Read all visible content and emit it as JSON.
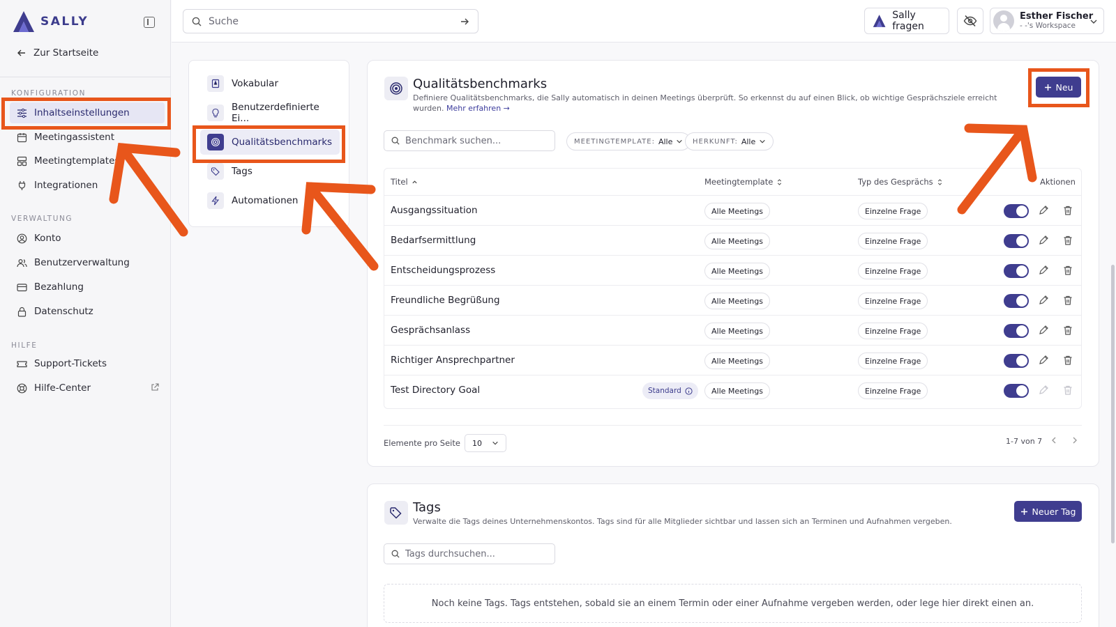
{
  "app": {
    "brand": "SALLY",
    "back_link": "Zur Startseite"
  },
  "sidebar": {
    "sections": [
      {
        "title": "KONFIGURATION",
        "items": [
          {
            "label": "Inhaltseinstellungen",
            "icon": "sliders-icon",
            "active": true
          },
          {
            "label": "Meetingassistent",
            "icon": "calendar-icon"
          },
          {
            "label": "Meetingtemplates",
            "icon": "template-icon"
          },
          {
            "label": "Integrationen",
            "icon": "plug-icon"
          }
        ]
      },
      {
        "title": "VERWALTUNG",
        "items": [
          {
            "label": "Konto",
            "icon": "user-circle-icon"
          },
          {
            "label": "Benutzerverwaltung",
            "icon": "users-icon"
          },
          {
            "label": "Bezahlung",
            "icon": "credit-card-icon"
          },
          {
            "label": "Datenschutz",
            "icon": "lock-icon"
          }
        ]
      },
      {
        "title": "HILFE",
        "items": [
          {
            "label": "Support-Tickets",
            "icon": "ticket-icon"
          },
          {
            "label": "Hilfe-Center",
            "icon": "lifebuoy-icon",
            "external": true
          }
        ]
      }
    ]
  },
  "topbar": {
    "search_placeholder": "Suche",
    "ask_sally": "Sally fragen",
    "user_name": "Esther Fischer",
    "workspace": "- -'s Workspace"
  },
  "content_nav": {
    "items": [
      {
        "label": "Vokabular",
        "icon": "book-icon"
      },
      {
        "label": "Benutzerdefinierte Ei...",
        "icon": "lightbulb-icon"
      },
      {
        "label": "Qualitätsbenchmarks",
        "icon": "target-icon",
        "active": true
      },
      {
        "label": "Tags",
        "icon": "tag-icon"
      },
      {
        "label": "Automationen",
        "icon": "bolt-icon"
      }
    ]
  },
  "benchmarks": {
    "title": "Qualitätsbenchmarks",
    "description": "Definiere Qualitätsbenchmarks, die Sally automatisch in deinen Meetings überprüft. So erkennst du auf einen Blick, ob wichtige Gesprächsziele erreicht wurden.",
    "learn_more_1": "Mehr",
    "learn_more_2": "erfahren →",
    "new_button": "Neu",
    "search_placeholder": "Benchmark suchen...",
    "filters": [
      {
        "label": "MEETINGTEMPLATE:",
        "value": "Alle"
      },
      {
        "label": "HERKUNFT:",
        "value": "Alle"
      }
    ],
    "columns": {
      "title": "Titel",
      "template": "Meetingtemplate",
      "type": "Typ des Gesprächs",
      "actions": "Aktionen"
    },
    "rows": [
      {
        "title": "Ausgangssituation",
        "template": "Alle Meetings",
        "type": "Einzelne Frage"
      },
      {
        "title": "Bedarfsermittlung",
        "template": "Alle Meetings",
        "type": "Einzelne Frage"
      },
      {
        "title": "Entscheidungsprozess",
        "template": "Alle Meetings",
        "type": "Einzelne Frage"
      },
      {
        "title": "Freundliche Begrüßung",
        "template": "Alle Meetings",
        "type": "Einzelne Frage"
      },
      {
        "title": "Gesprächsanlass",
        "template": "Alle Meetings",
        "type": "Einzelne Frage"
      },
      {
        "title": "Richtiger Ansprechpartner",
        "template": "Alle Meetings",
        "type": "Einzelne Frage"
      },
      {
        "title": "Test Directory Goal",
        "template": "Alle Meetings",
        "type": "Einzelne Frage",
        "badge": "Standard"
      }
    ],
    "per_page_label": "Elemente pro Seite",
    "per_page_value": "10",
    "page_info": "1-7 von 7"
  },
  "tags": {
    "title": "Tags",
    "description": "Verwalte die Tags deines Unternehmenskontos. Tags sind für alle Mitglieder sichtbar und lassen sich an Terminen und Aufnahmen vergeben.",
    "new_button": "Neuer Tag",
    "search_placeholder": "Tags durchsuchen...",
    "empty": "Noch keine Tags. Tags entstehen, sobald sie an einem Termin oder einer Aufnahme vergeben werden, oder lege hier direkt einen an."
  },
  "colors": {
    "accent": "#3f3d8f",
    "annotation": "#e8561b"
  }
}
